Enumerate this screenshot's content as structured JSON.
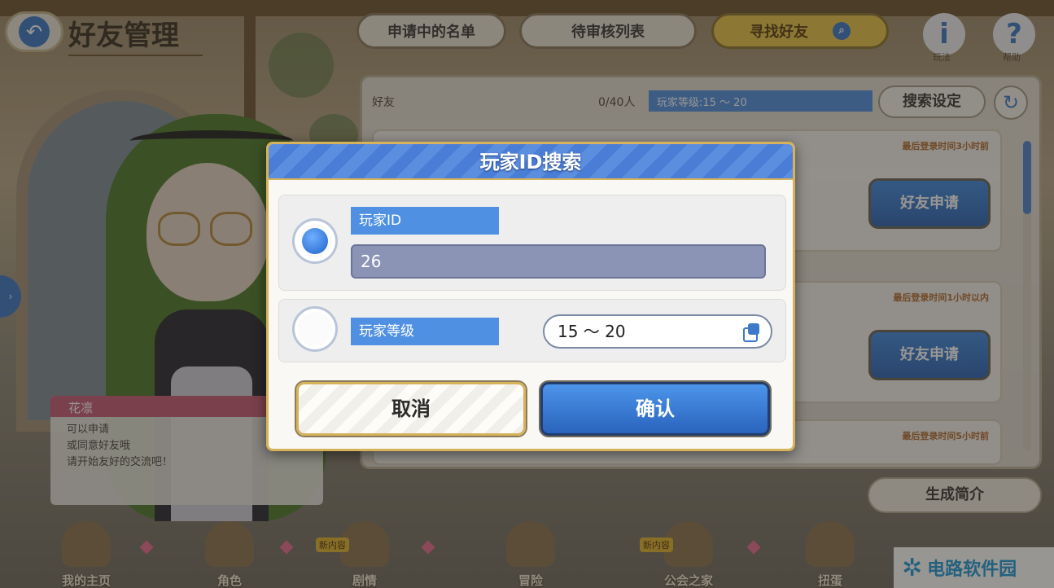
{
  "header": {
    "title": "好友管理",
    "tabs": [
      "申请中的名单",
      "待审核列表",
      "寻找好友"
    ],
    "help_buttons": [
      {
        "icon": "info-icon",
        "label": "玩法"
      },
      {
        "icon": "help-icon",
        "label": "帮助"
      }
    ]
  },
  "panel": {
    "friends_label": "好友",
    "count": "0/40人",
    "filter_text": "玩家等级:15 ～ 20",
    "search_settings": "搜索设定",
    "cards": [
      {
        "login_time": "最后登录时间3小时前",
        "button": "好友申请"
      },
      {
        "login_time": "最后登录时间1小时以内",
        "button": "好友申请"
      },
      {
        "login_time": "最后登录时间5小时前",
        "button": ""
      }
    ],
    "generate_profile": "生成简介"
  },
  "speech": {
    "name": "花凛",
    "lines": [
      "可以申请",
      "或同意好友哦",
      "请开始友好的交流吧！"
    ]
  },
  "dialog": {
    "title": "玩家ID搜索",
    "option_id": {
      "label": "玩家ID",
      "value": "26",
      "selected": true
    },
    "option_level": {
      "label": "玩家等级",
      "value": "15 ～ 20",
      "selected": false
    },
    "cancel": "取消",
    "confirm": "确认"
  },
  "bottom_nav": [
    {
      "label": "我的主页"
    },
    {
      "label": "角色"
    },
    {
      "label": "剧情",
      "badge": "新内容"
    },
    {
      "label": "冒险"
    },
    {
      "label": "公会之家",
      "badge": "新内容"
    },
    {
      "label": "扭蛋"
    }
  ],
  "watermark": {
    "text": "电路软件园"
  },
  "colors": {
    "accent_blue": "#4f90e2",
    "gold": "#d6b25a",
    "confirm_blue": "#2a63bd"
  }
}
